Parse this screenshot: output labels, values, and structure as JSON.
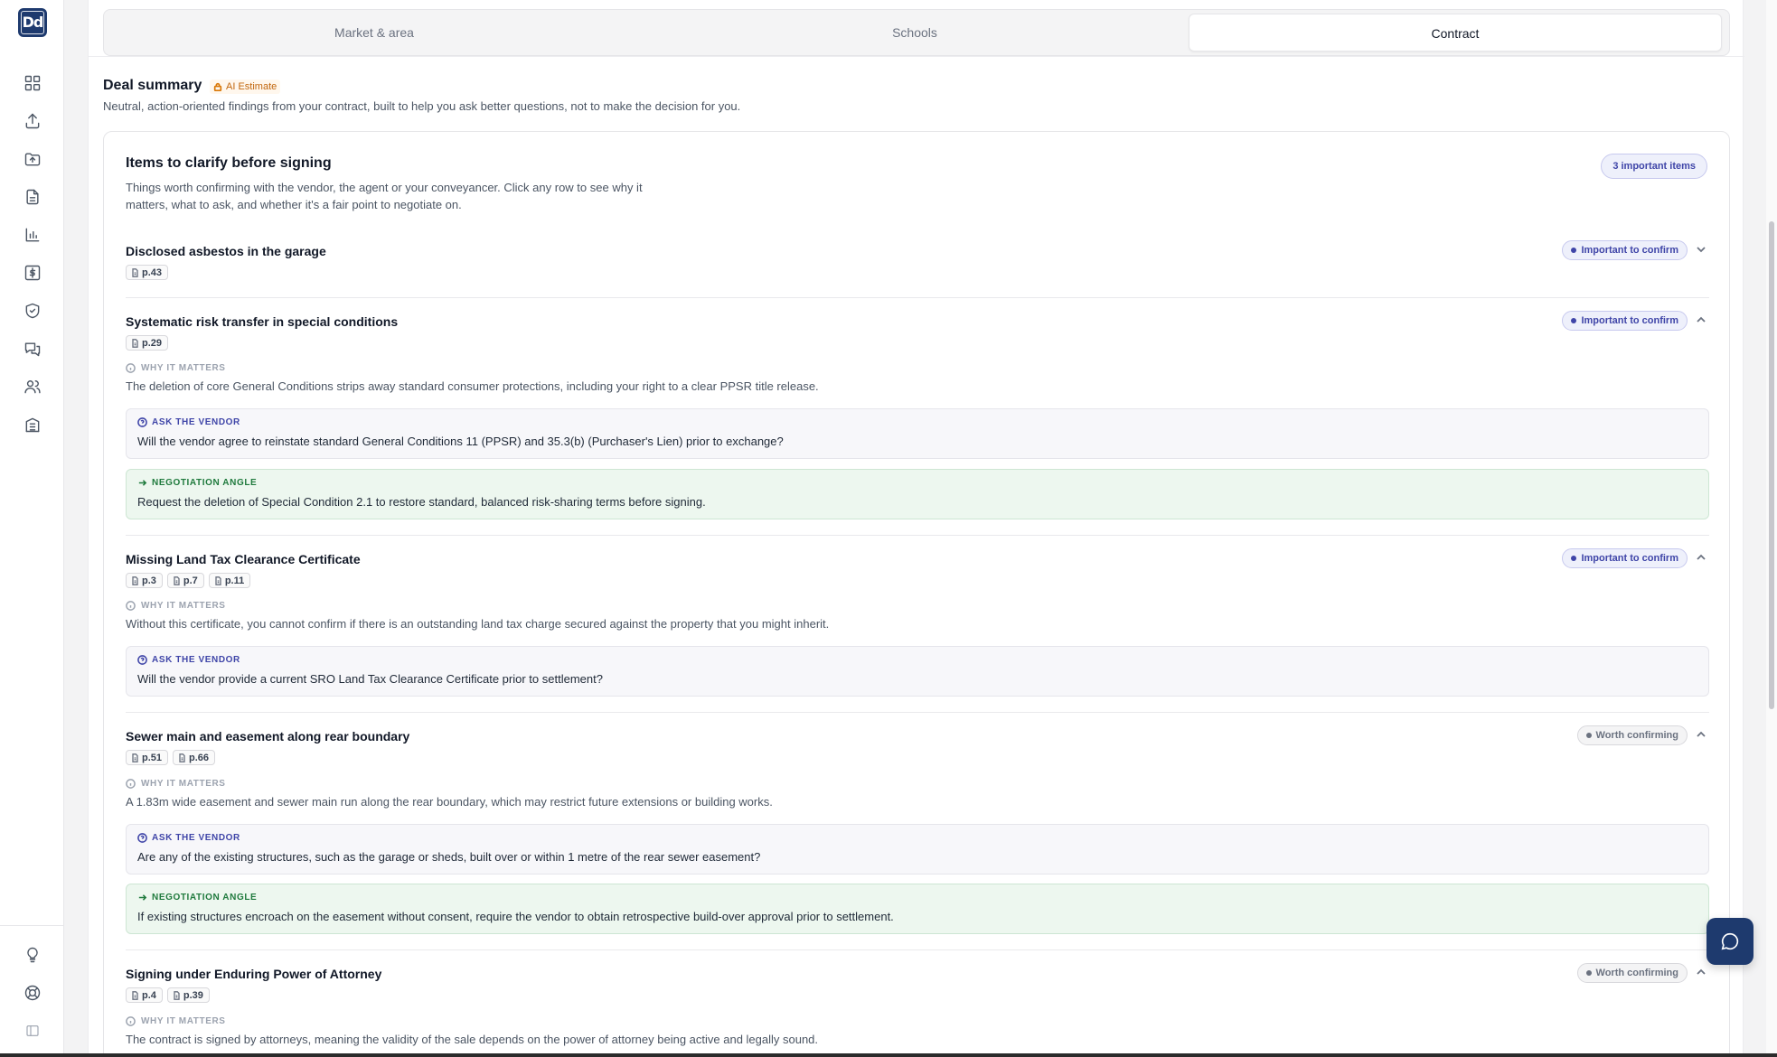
{
  "app": {
    "logo_text": "Dd"
  },
  "sidebar": {
    "items": [
      {
        "icon": "dashboard-icon"
      },
      {
        "icon": "upload-icon"
      },
      {
        "icon": "folder-upload-icon"
      },
      {
        "icon": "document-icon"
      },
      {
        "icon": "bar-chart-icon"
      },
      {
        "icon": "dollar-icon"
      },
      {
        "icon": "shield-check-icon"
      },
      {
        "icon": "messages-icon"
      },
      {
        "icon": "users-icon"
      },
      {
        "icon": "building-icon"
      }
    ],
    "bottom_items": [
      {
        "icon": "lightbulb-icon"
      },
      {
        "icon": "help-lifebuoy-icon"
      },
      {
        "icon": "sidebar-toggle-icon"
      }
    ]
  },
  "tabs": [
    {
      "label": "Market & area",
      "active": false
    },
    {
      "label": "Schools",
      "active": false
    },
    {
      "label": "Contract",
      "active": true
    }
  ],
  "deal_summary": {
    "title": "Deal summary",
    "badge": "AI Estimate",
    "subtitle": "Neutral, action-oriented findings from your contract, built to help you ask better questions, not to make the decision for you."
  },
  "clarify": {
    "title": "Items to clarify before signing",
    "description": "Things worth confirming with the vendor, the agent or your conveyancer. Click any row to see why it matters, what to ask, and whether it's a fair point to negotiate on.",
    "count_badge": "3 important items",
    "labels": {
      "why": "WHY IT MATTERS",
      "ask": "ASK THE VENDOR",
      "negotiate": "NEGOTIATION ANGLE"
    },
    "items": [
      {
        "title": "Disclosed asbestos in the garage",
        "pages": [
          "p.43"
        ],
        "status": "Important to confirm",
        "expanded": false
      },
      {
        "title": "Systematic risk transfer in special conditions",
        "pages": [
          "p.29"
        ],
        "status": "Important to confirm",
        "expanded": true,
        "why": "The deletion of core General Conditions strips away standard consumer protections, including your right to a clear PPSR title release.",
        "ask": "Will the vendor agree to reinstate standard General Conditions 11 (PPSR) and 35.3(b) (Purchaser's Lien) prior to exchange?",
        "negotiate": "Request the deletion of Special Condition 2.1 to restore standard, balanced risk-sharing terms before signing."
      },
      {
        "title": "Missing Land Tax Clearance Certificate",
        "pages": [
          "p.3",
          "p.7",
          "p.11"
        ],
        "status": "Important to confirm",
        "expanded": true,
        "why": "Without this certificate, you cannot confirm if there is an outstanding land tax charge secured against the property that you might inherit.",
        "ask": "Will the vendor provide a current SRO Land Tax Clearance Certificate prior to settlement?"
      },
      {
        "title": "Sewer main and easement along rear boundary",
        "pages": [
          "p.51",
          "p.66"
        ],
        "status": "Worth confirming",
        "expanded": true,
        "why": "A 1.83m wide easement and sewer main run along the rear boundary, which may restrict future extensions or building works.",
        "ask": "Are any of the existing structures, such as the garage or sheds, built over or within 1 metre of the rear sewer easement?",
        "negotiate": "If existing structures encroach on the easement without consent, require the vendor to obtain retrospective build-over approval prior to settlement."
      },
      {
        "title": "Signing under Enduring Power of Attorney",
        "pages": [
          "p.4",
          "p.39"
        ],
        "status": "Worth confirming",
        "expanded": true,
        "why": "The contract is signed by attorneys, meaning the validity of the sale depends on the power of attorney being active and legally sound."
      }
    ]
  },
  "chat": {
    "icon": "chat-bubble-icon"
  },
  "colors": {
    "brand": "#1e3a6e",
    "important": "#3f45a8",
    "negotiation": "#1f7a3d",
    "ai_badge": "#c2670e"
  }
}
